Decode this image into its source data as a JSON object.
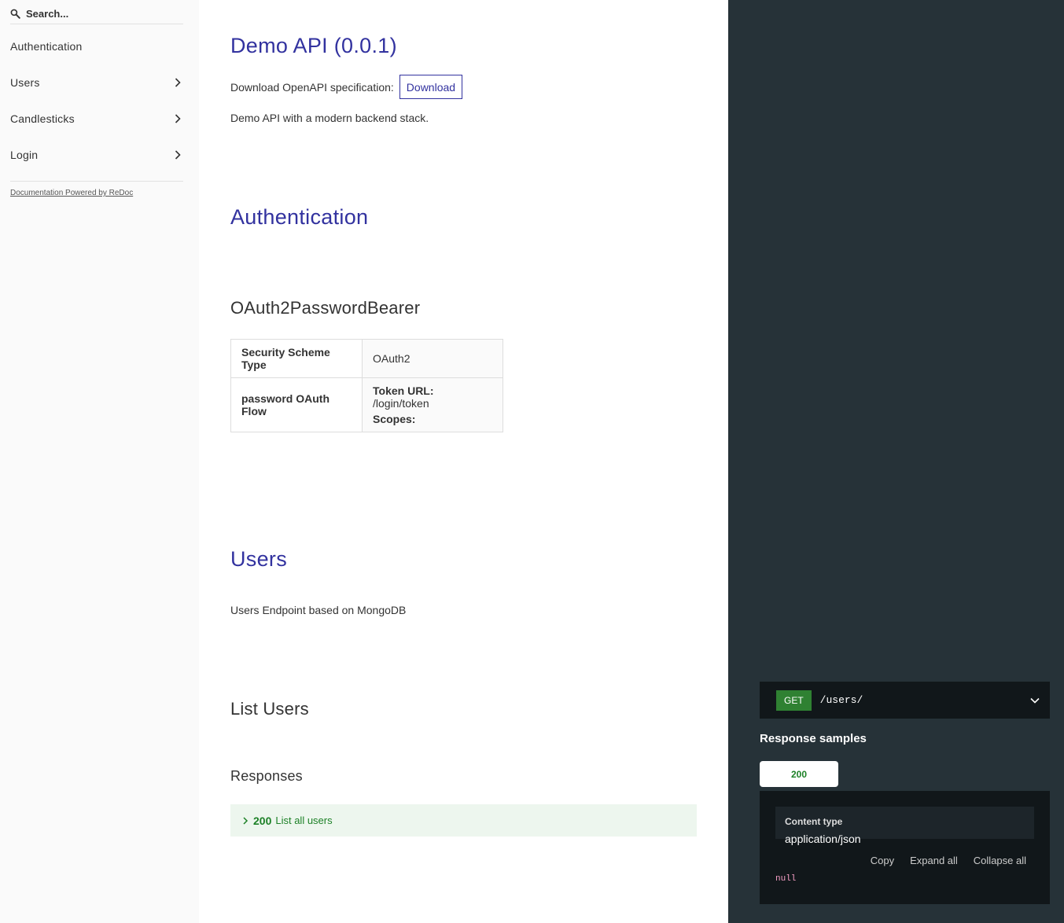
{
  "sidebar": {
    "search_placeholder": "Search...",
    "items": [
      {
        "label": "Authentication"
      },
      {
        "label": "Users"
      },
      {
        "label": "Candlesticks"
      },
      {
        "label": "Login"
      }
    ],
    "powered_by": "Documentation Powered by ReDoc"
  },
  "main": {
    "title": "Demo API (0.0.1)",
    "download_label": "Download OpenAPI specification:",
    "download_button": "Download",
    "description": "Demo API with a modern backend stack.",
    "auth_heading": "Authentication",
    "scheme_heading": "OAuth2PasswordBearer",
    "security_table": {
      "row1_key": "Security Scheme Type",
      "row1_value": "OAuth2",
      "row2_key": "password OAuth Flow",
      "token_url_label": "Token URL:",
      "token_url_value": "/login/token",
      "scopes_label": "Scopes:"
    },
    "users_heading": "Users",
    "users_description": "Users Endpoint based on MongoDB",
    "list_users_heading": "List Users",
    "responses_heading": "Responses",
    "response_code": "200",
    "response_text": "List all users"
  },
  "right": {
    "method": "GET",
    "path": "/users/",
    "response_samples_title": "Response samples",
    "tab_label": "200",
    "content_type_label": "Content type",
    "content_type_value": "application/json",
    "copy": "Copy",
    "expand_all": "Expand all",
    "collapse_all": "Collapse all",
    "sample_value": "null"
  },
  "colors": {
    "accent": "#32329f",
    "success": "#1d8127",
    "right_panel": "#263238",
    "code_bg": "#11171a"
  }
}
